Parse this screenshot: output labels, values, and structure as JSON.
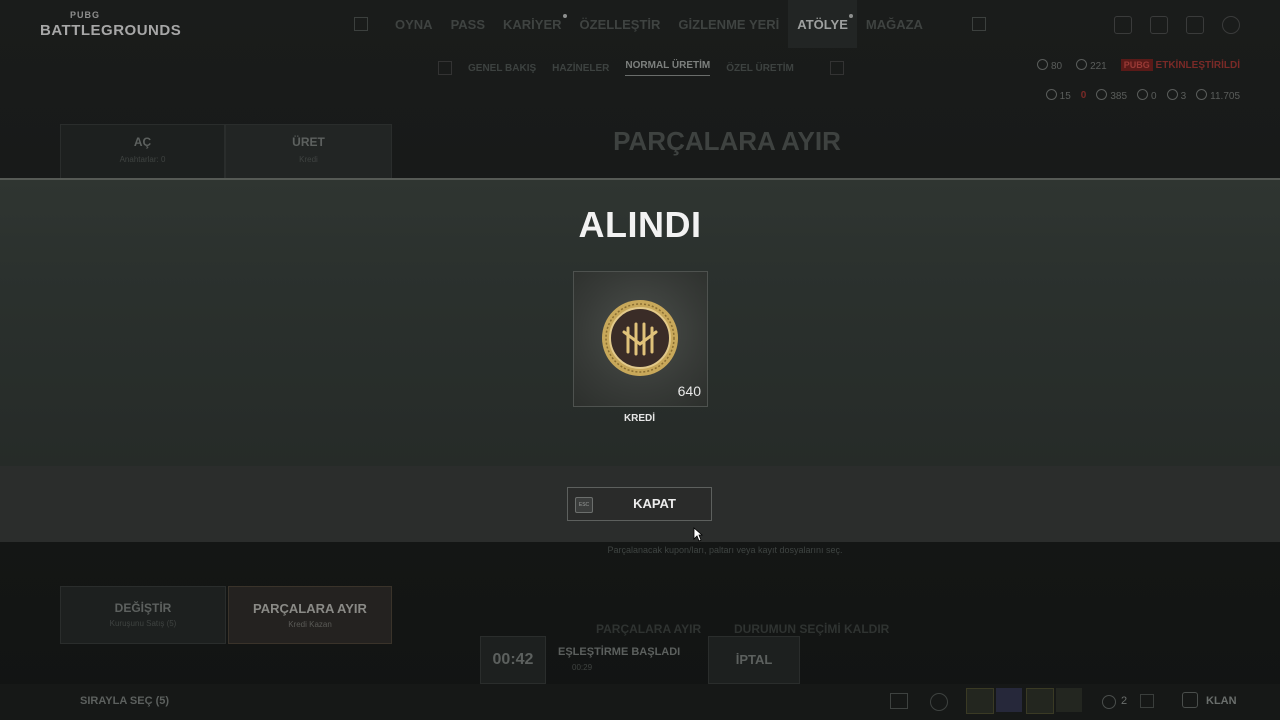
{
  "header": {
    "logo_small": "PUBG",
    "logo_big": "BATTLEGROUNDS",
    "nav": [
      "OYNA",
      "PASS",
      "KARİYER",
      "ÖZELLEŞTİR",
      "GİZLENME YERİ",
      "ATÖLYE",
      "MAĞAZA"
    ],
    "active_nav": "ATÖLYE"
  },
  "subnav": [
    "GENEL BAKIŞ",
    "HAZİNELER",
    "NORMAL ÜRETİM",
    "ÖZEL ÜRETİM"
  ],
  "resources": {
    "r1": "80",
    "r2": "221",
    "tag": "PUBG",
    "tag_text": "ETKİNLEŞTİRİLDİ",
    "r3": "15",
    "r4": "0",
    "r5": "385",
    "r6": "0",
    "r7": "3",
    "r8": "11.705"
  },
  "background": {
    "tab_open": "AÇ",
    "tab_open_sub": "Anahtarlar: 0",
    "tab_craft": "ÜRET",
    "tab_craft_sub": "Kredi",
    "title": "PARÇALARA AYIR",
    "hint": "Parçalanacak kupon/ları, paltarı veya kayıt dosyalarını seç.",
    "btn_change": "DEĞİŞTİR",
    "btn_change_sub": "Kuruşunu Satış (5)",
    "btn_dismantle": "PARÇALARA AYIR",
    "btn_dismantle_sub": "Kredi Kazan",
    "timer": "00:42",
    "match_title": "EŞLEŞTİRME BAŞLADI",
    "match_sub": "00:29",
    "match_cancel": "İPTAL",
    "bottom_left": "SIRAYLA SEÇ (5)",
    "party_count": "2",
    "clan": "KLAN",
    "dismantle_tab": "PARÇALARA AYIR",
    "select_tab": "DURUMUN SEÇİMİ KALDIR"
  },
  "modal": {
    "title": "ALINDI",
    "item_name": "KREDİ",
    "item_quantity": "640",
    "close_key": "ESC",
    "close_label": "KAPAT"
  },
  "colors": {
    "modal_bg": "#2a302d",
    "accent_gold": "#c8a85a"
  }
}
